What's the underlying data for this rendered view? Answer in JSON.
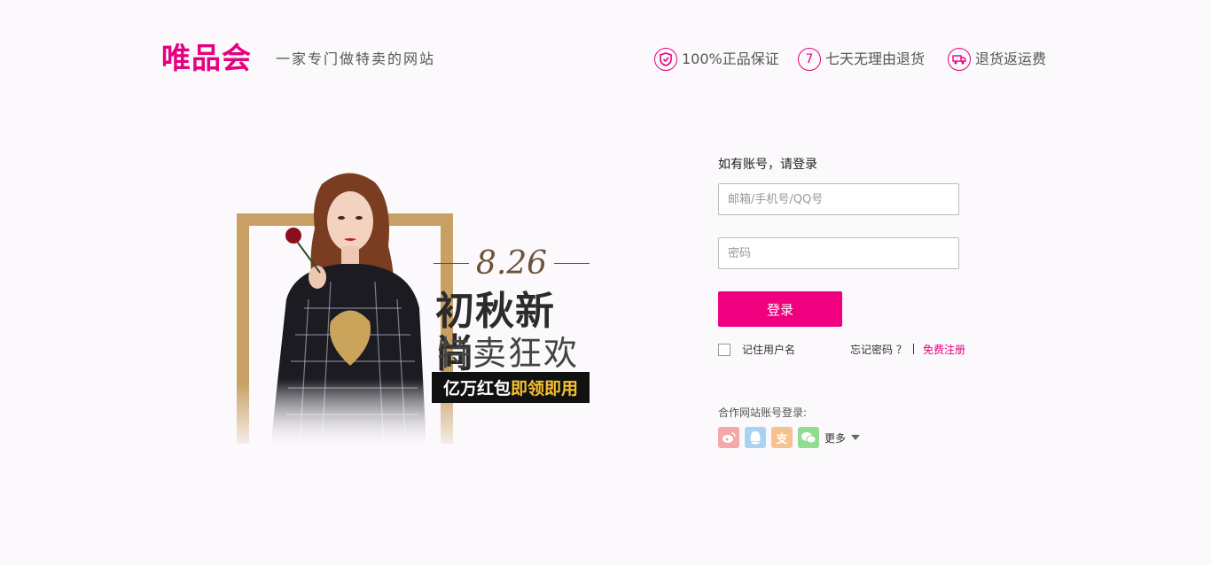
{
  "header": {
    "logo": "唯品会",
    "slogan": "一家专门做特卖的网站",
    "promises": [
      {
        "icon": "shield-icon",
        "glyph": "✓",
        "label": "100%正品保证"
      },
      {
        "icon": "seven-days-icon",
        "glyph": "7",
        "label": "七天无理由退货"
      },
      {
        "icon": "truck-icon",
        "glyph": "⛟",
        "label": "退货返运费"
      }
    ]
  },
  "banner": {
    "date": "8.26",
    "headline": "初秋新尚",
    "subline": "特卖狂欢",
    "badge_main": "亿万红包",
    "badge_highlight": "即领即用"
  },
  "login": {
    "title": "如有账号，请登录",
    "username_placeholder": "邮箱/手机号/QQ号",
    "username_value": "",
    "password_placeholder": "密码",
    "password_value": "",
    "submit_label": "登录",
    "remember_label": "记住用户名",
    "forgot_label": "忘记密码 ？",
    "register_label": "免费注册",
    "partner_title": "合作网站账号登录:",
    "partners": [
      {
        "icon": "weibo-icon",
        "glyph": "微"
      },
      {
        "icon": "qq-icon",
        "glyph": "Q"
      },
      {
        "icon": "alipay-icon",
        "glyph": "支"
      },
      {
        "icon": "wechat-icon",
        "glyph": "微"
      }
    ],
    "more_label": "更多"
  },
  "colors": {
    "brand": "#e5007e",
    "button": "#f0007f",
    "background": "#fcf9fc",
    "badge_highlight": "#f6c12f"
  }
}
